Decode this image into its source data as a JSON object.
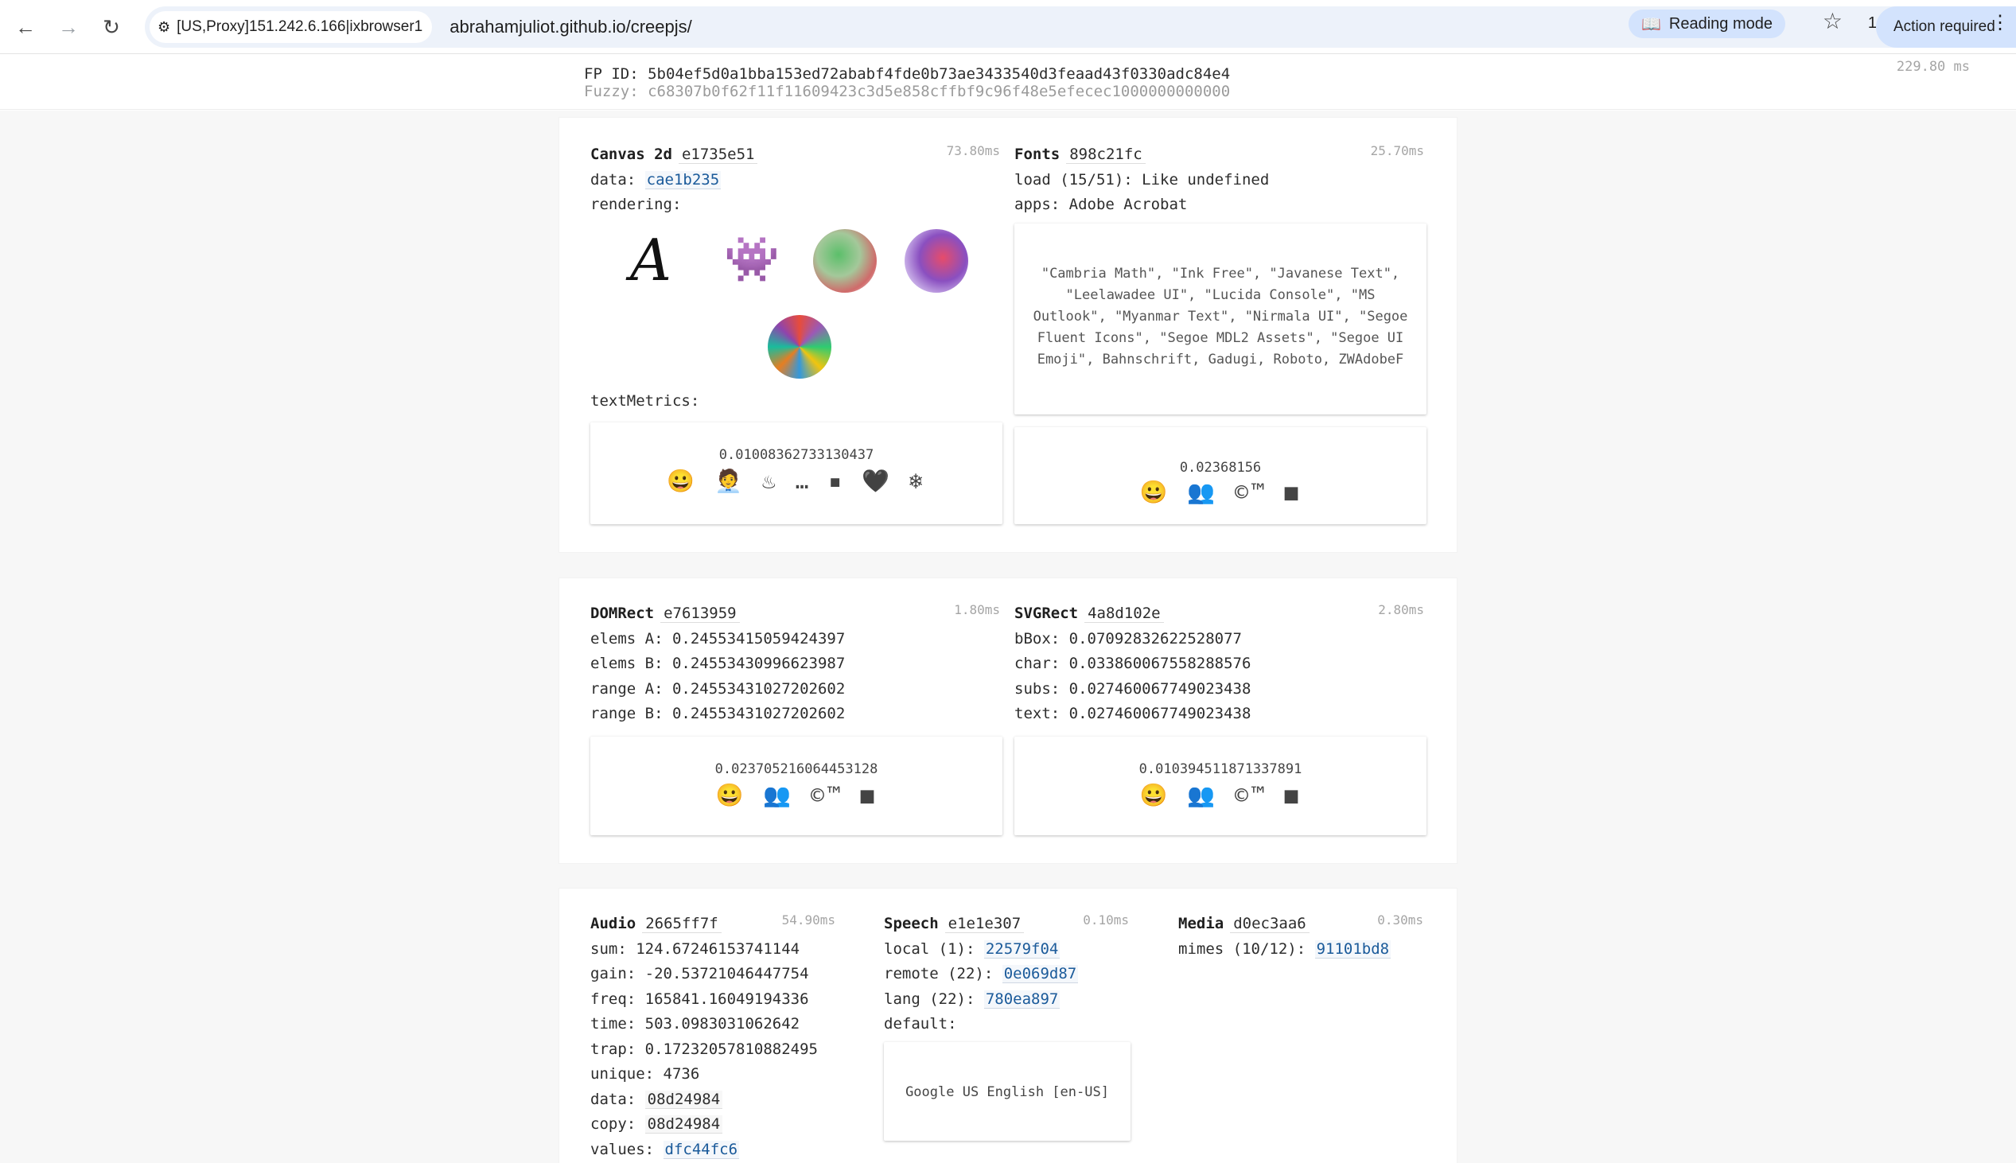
{
  "browser": {
    "site_chip": "[US,Proxy]151.242.6.166|ixbrowser1",
    "url": "abrahamjuliot.github.io/creepjs/",
    "reading_mode": "Reading mode",
    "tab_count": "1",
    "action_required": "Action required"
  },
  "fp": {
    "id_label": "FP ID:",
    "id": "5b04ef5d0a1bba153ed72ababf4fde0b73ae3433540d3feaad43f0330adc84e4",
    "fuzzy_label": "Fuzzy:",
    "fuzzy": "c68307b0f62f11f11609423c3d5e858cffbf9c96f48e5efecec1000000000000",
    "time": "229.80 ms"
  },
  "canvas": {
    "title": "Canvas 2d",
    "hash": "e1735e51",
    "time": "73.80ms",
    "data_label": "data:",
    "data": "cae1b235",
    "rendering_label": "rendering:",
    "glyph": "A",
    "invader": "👾",
    "textmetrics_label": "textMetrics:",
    "metric": "0.01008362733130437",
    "emojis": "😀 🧑‍💼 ♨ … ▪ 🖤 ❄"
  },
  "fonts": {
    "title": "Fonts",
    "hash": "898c21fc",
    "time": "25.70ms",
    "load": "load (15/51): Like undefined",
    "apps": "apps: Adobe Acrobat",
    "list": "\"Cambria Math\", \"Ink Free\", \"Javanese Text\", \"Leelawadee UI\", \"Lucida Console\", \"MS Outlook\", \"Myanmar Text\", \"Nirmala UI\", \"Segoe Fluent Icons\", \"Segoe MDL2 Assets\", \"Segoe UI Emoji\", Bahnschrift, Gadugi, Roboto, ZWAdobeF",
    "metric": "0.02368156",
    "emojis": "😀 👥 ©™ ■"
  },
  "domrect": {
    "title": "DOMRect",
    "hash": "e7613959",
    "time": "1.80ms",
    "lines": [
      "elems A: 0.24553415059424397",
      "elems B: 0.24553430996623987",
      "range A: 0.24553431027202602",
      "range B: 0.24553431027202602"
    ],
    "metric": "0.023705216064453128",
    "emojis": "😀 👥 ©™ ■"
  },
  "svgrect": {
    "title": "SVGRect",
    "hash": "4a8d102e",
    "time": "2.80ms",
    "lines": [
      "bBox: 0.07092832622528077",
      "char: 0.033860067558288576",
      "subs: 0.027460067749023438",
      "text: 0.027460067749023438"
    ],
    "metric": "0.010394511871337891",
    "emojis": "😀 👥 ©™ ■"
  },
  "audio": {
    "title": "Audio",
    "hash": "2665ff7f",
    "time": "54.90ms",
    "lines": [
      "sum: 124.67246153741144",
      "gain: -20.53721046447754",
      "freq: 165841.16049194336",
      "time: 503.0983031062642",
      "trap: 0.17232057810882495",
      "unique: 4736"
    ],
    "data_label": "data:",
    "data": "08d24984",
    "copy_label": "copy:",
    "copy": "08d24984",
    "values_label": "values:",
    "values": "dfc44fc6"
  },
  "speech": {
    "title": "Speech",
    "hash": "e1e1e307",
    "time": "0.10ms",
    "local_label": "local (1):",
    "local": "22579f04",
    "remote_label": "remote (22):",
    "remote": "0e069d87",
    "lang_label": "lang (22):",
    "lang": "780ea897",
    "default_label": "default:",
    "default_voice": "Google US English [en-US]"
  },
  "media": {
    "title": "Media",
    "hash": "d0ec3aa6",
    "time": "0.30ms",
    "mimes_label": "mimes (10/12):",
    "mimes": "91101bd8"
  }
}
